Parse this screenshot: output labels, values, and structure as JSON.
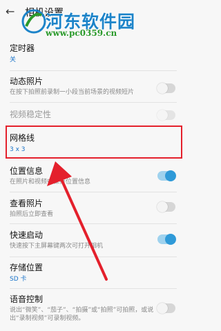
{
  "header": {
    "back_icon": "back-arrow-icon",
    "title": "相机设置"
  },
  "watermark": {
    "name": "河东软件园",
    "url": "www.pc0359.cn"
  },
  "items": [
    {
      "label": "定时器",
      "value": "关"
    },
    {
      "label": "动态照片",
      "sub": "在按下拍照前录制一小段当前场景的视频短片",
      "toggle": "off"
    },
    {
      "label": "视频稳定性",
      "toggle": "off",
      "disabled": true
    },
    {
      "label": "网格线",
      "value": "3 x 3"
    },
    {
      "label": "位置信息",
      "sub": "在照片和视频中保存位置信息",
      "toggle": "on"
    },
    {
      "label": "查看照片",
      "sub": "拍照后立即查看",
      "toggle": "off"
    },
    {
      "label": "快速启动",
      "sub": "快速按下主屏幕键两次可打开相机",
      "toggle": "on"
    },
    {
      "label": "存储位置",
      "value": "SD 卡"
    },
    {
      "label": "语音控制",
      "sub": "说出“微笑”、“茄子”、“拍摄”或“拍照”可拍照，或说出“录制视频”可录制视频。",
      "toggle": "off"
    }
  ],
  "colors": {
    "accent": "#2f9ad8",
    "highlight": "#e4202c",
    "watermark_blue": "#1d84c9",
    "watermark_green": "#2b9a2b"
  }
}
